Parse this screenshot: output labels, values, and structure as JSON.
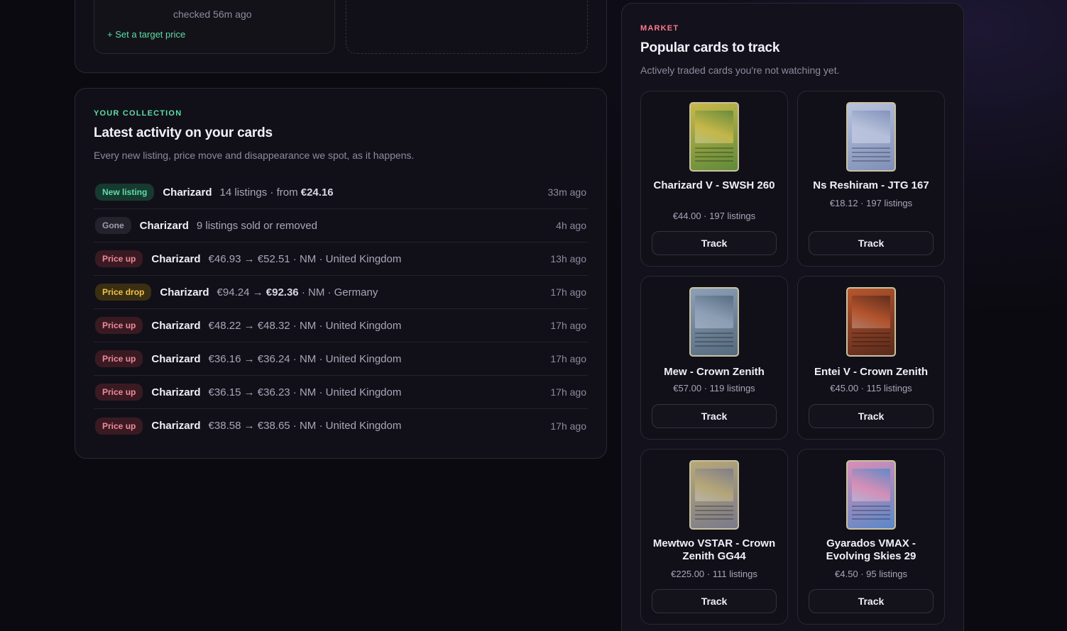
{
  "top": {
    "checked": "checked 56m ago",
    "target_link": "+ Set a target price"
  },
  "collection": {
    "eyebrow": "YOUR COLLECTION",
    "title": "Latest activity on your cards",
    "subtitle": "Every new listing, price move and disappearance we spot, as it happens.",
    "rows": [
      {
        "badge": "New listing",
        "kind": "new",
        "card": "Charizard",
        "detail": "14 listings · from ",
        "bold": "€24.16",
        "time": "33m ago"
      },
      {
        "badge": "Gone",
        "kind": "gone",
        "card": "Charizard",
        "detail": "9 listings sold or removed",
        "bold": "",
        "time": "4h ago"
      },
      {
        "badge": "Price up",
        "kind": "up",
        "card": "Charizard",
        "detail": "€46.93 → €52.51 · NM · United Kingdom",
        "bold": "",
        "time": "13h ago"
      },
      {
        "badge": "Price drop",
        "kind": "drop",
        "card": "Charizard",
        "detail": "€94.24 → ",
        "bold": "€92.36",
        "tail": " · NM · Germany",
        "time": "17h ago"
      },
      {
        "badge": "Price up",
        "kind": "up",
        "card": "Charizard",
        "detail": "€48.22 → €48.32 · NM · United Kingdom",
        "bold": "",
        "time": "17h ago"
      },
      {
        "badge": "Price up",
        "kind": "up",
        "card": "Charizard",
        "detail": "€36.16 → €36.24 · NM · United Kingdom",
        "bold": "",
        "time": "17h ago"
      },
      {
        "badge": "Price up",
        "kind": "up",
        "card": "Charizard",
        "detail": "€36.15 → €36.23 · NM · United Kingdom",
        "bold": "",
        "time": "17h ago"
      },
      {
        "badge": "Price up",
        "kind": "up",
        "card": "Charizard",
        "detail": "€38.58 → €38.65 · NM · United Kingdom",
        "bold": "",
        "time": "17h ago"
      }
    ]
  },
  "market": {
    "eyebrow": "MARKET",
    "title": "Popular cards to track",
    "subtitle": "Actively traded cards you're not watching yet.",
    "track_label": "Track",
    "cards": [
      {
        "name": "Charizard V - SWSH 260",
        "price": "€44.00 · 197 listings",
        "art": "#c9b84a",
        "art2": "#5f8a3a"
      },
      {
        "name": "Ns Reshiram - JTG 167",
        "price": "€18.12 · 197 listings",
        "art": "#b9c3dd",
        "art2": "#7f8fb8"
      },
      {
        "name": "Mew - Crown Zenith",
        "price": "€57.00 · 119 listings",
        "art": "#8ea0b8",
        "art2": "#546a7d"
      },
      {
        "name": "Entei V - Crown Zenith",
        "price": "€45.00 · 115 listings",
        "art": "#b8562e",
        "art2": "#5a2a1c"
      },
      {
        "name": "Mewtwo VSTAR - Crown Zenith GG44",
        "price": "€225.00 · 111 listings",
        "art": "#b7a878",
        "art2": "#7a7a8a"
      },
      {
        "name": "Gyarados VMAX - Evolving Skies 29",
        "price": "€4.50 · 95 listings",
        "art": "#d98fb6",
        "art2": "#5a88c8"
      }
    ]
  }
}
